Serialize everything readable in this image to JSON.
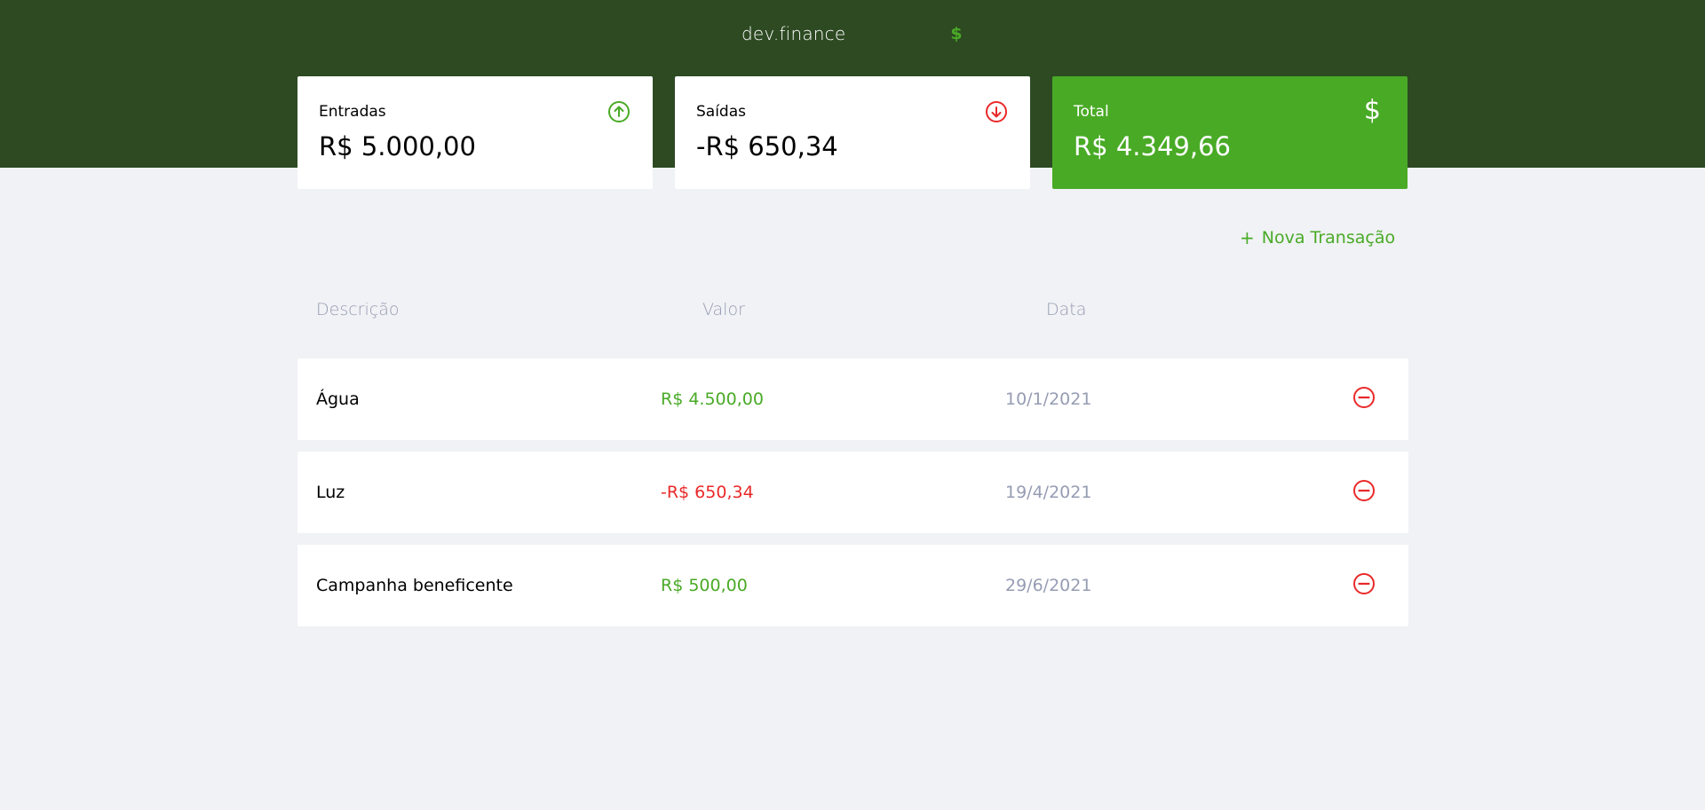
{
  "header": {
    "logo_text": "dev.finance",
    "logo_icon": "$"
  },
  "balance": {
    "income": {
      "label": "Entradas",
      "value": "R$ 5.000,00",
      "icon": "arrow-up-circle-icon",
      "color": "#49aa26"
    },
    "expense": {
      "label": "Saídas",
      "value": "-R$ 650,34",
      "icon": "arrow-down-circle-icon",
      "color": "#e92929"
    },
    "total": {
      "label": "Total",
      "value": "R$ 4.349,66",
      "icon": "$",
      "color": "#49aa26"
    }
  },
  "actions": {
    "new_transaction_plus": "+",
    "new_transaction_label": "Nova Transação"
  },
  "table": {
    "headers": {
      "description": "Descrição",
      "amount": "Valor",
      "date": "Data"
    },
    "rows": [
      {
        "description": "Água",
        "amount": "R$ 4.500,00",
        "date": "10/1/2021",
        "type": "income"
      },
      {
        "description": "Luz",
        "amount": "-R$ 650,34",
        "date": "19/4/2021",
        "type": "expense"
      },
      {
        "description": "Campanha beneficente",
        "amount": "R$ 500,00",
        "date": "29/6/2021",
        "type": "income"
      }
    ]
  },
  "colors": {
    "header_bg": "#2d4a22",
    "accent_green": "#49aa26",
    "expense_red": "#e92929",
    "page_bg": "#f0f2f5",
    "muted_text": "#969cb3"
  }
}
